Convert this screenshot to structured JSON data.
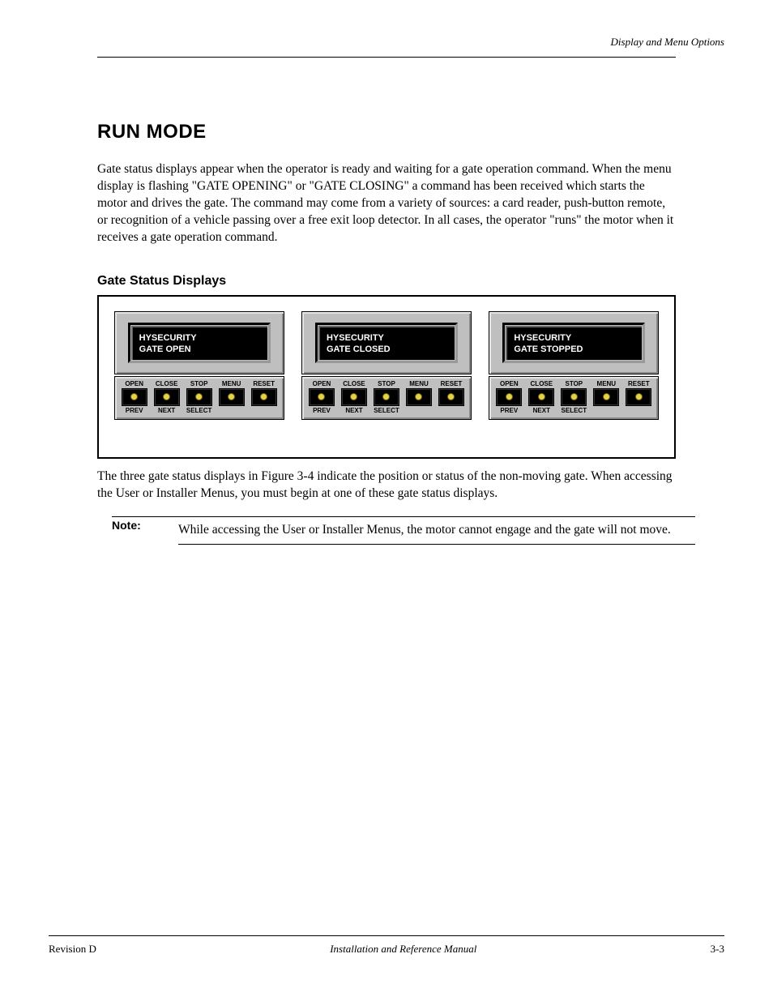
{
  "header": {
    "right": "Display and Menu Options"
  },
  "section_title": "RUN MODE",
  "para1": "Gate status displays appear when the operator is ready and waiting for a gate operation command. When the menu display is flashing \"GATE OPENING\" or \"GATE CLOSING\" a command has been received which starts the motor and drives the gate. The command may come from a variety of sources: a card reader, push-button remote, or recognition of a vehicle passing over a free exit loop detector. In all cases, the operator \"runs\" the motor when it receives a gate operation command.",
  "fig_title": "Gate Status Displays",
  "panels": [
    {
      "line1": "HYSECURITY",
      "line2": "GATE OPEN"
    },
    {
      "line1": "HYSECURITY",
      "line2": "GATE CLOSED"
    },
    {
      "line1": "HYSECURITY",
      "line2": "GATE STOPPED"
    }
  ],
  "btn_top": [
    "OPEN",
    "CLOSE",
    "STOP",
    "MENU",
    "RESET"
  ],
  "btn_bot": [
    "PREV",
    "NEXT",
    "SELECT",
    "",
    ""
  ],
  "caption": "The three gate status displays in Figure 3-4 indicate the position or status of the non-moving gate. When accessing the User or Installer Menus, you must begin at one of these gate status displays.",
  "note": {
    "label": "Note:",
    "text": "While accessing the User or Installer Menus, the motor cannot engage and the gate will not move."
  },
  "footer": {
    "left": "Revision D",
    "center": "Installation and Reference Manual",
    "right": "3-3"
  }
}
